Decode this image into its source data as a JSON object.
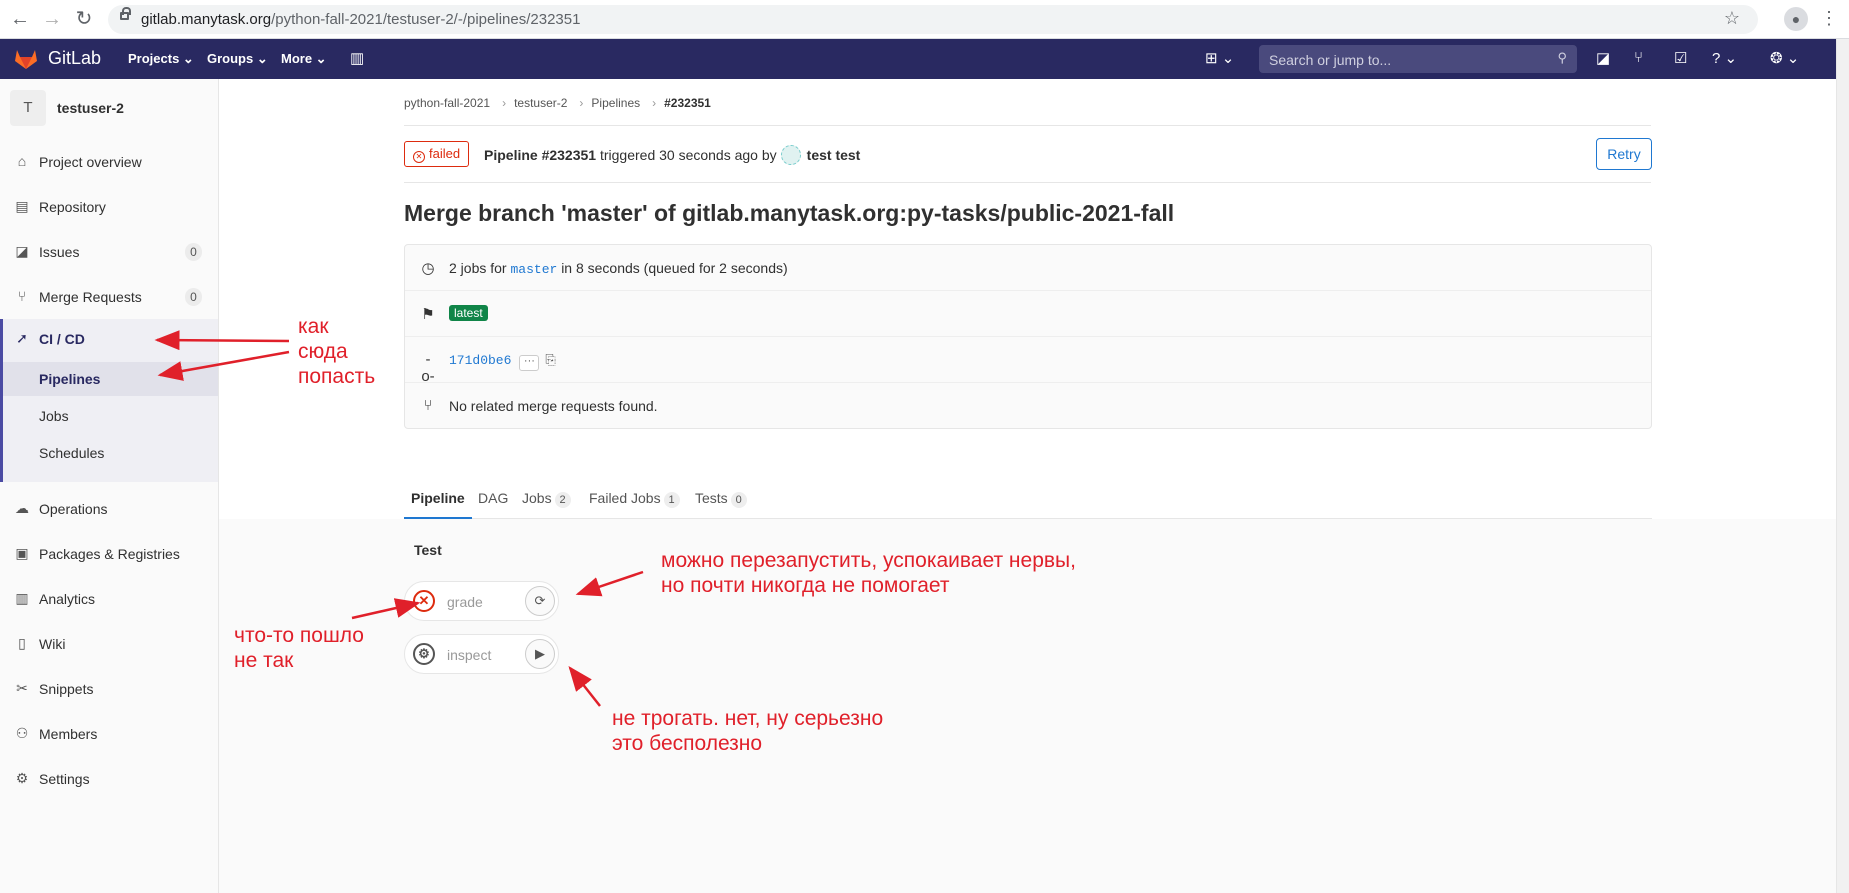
{
  "browser": {
    "url_host": "gitlab.manytask.org",
    "url_path": "/python-fall-2021/testuser-2/-/pipelines/232351"
  },
  "topbar": {
    "brand": "GitLab",
    "menus": [
      "Projects",
      "Groups",
      "More"
    ],
    "search_placeholder": "Search or jump to...",
    "accent": "#292961"
  },
  "sidebar": {
    "avatar_letter": "T",
    "project_name": "testuser-2",
    "items": [
      {
        "label": "Project overview",
        "icon": "home-icon"
      },
      {
        "label": "Repository",
        "icon": "doc-icon"
      },
      {
        "label": "Issues",
        "icon": "issues-icon",
        "count": "0"
      },
      {
        "label": "Merge Requests",
        "icon": "merge-request-icon",
        "count": "0"
      },
      {
        "label": "CI / CD",
        "icon": "rocket-icon"
      },
      {
        "label": "Operations",
        "icon": "cloud-icon"
      },
      {
        "label": "Packages & Registries",
        "icon": "package-icon"
      },
      {
        "label": "Analytics",
        "icon": "chart-icon"
      },
      {
        "label": "Wiki",
        "icon": "book-icon"
      },
      {
        "label": "Snippets",
        "icon": "scissors-icon"
      },
      {
        "label": "Members",
        "icon": "users-icon"
      },
      {
        "label": "Settings",
        "icon": "gear-icon"
      }
    ],
    "cicd_sub": [
      "Pipelines",
      "Jobs",
      "Schedules"
    ]
  },
  "breadcrumbs": [
    "python-fall-2021",
    "testuser-2",
    "Pipelines",
    "#232351"
  ],
  "pipeline": {
    "status": "failed",
    "id_label": "Pipeline #232351",
    "triggered_text": "triggered 30 seconds ago by",
    "user": "test test",
    "retry_label": "Retry",
    "title": "Merge branch 'master' of gitlab.manytask.org:py-tasks/public-2021-fall",
    "jobs_prefix": "2 jobs for",
    "branch": "master",
    "jobs_suffix": "in 8 seconds (queued for 2 seconds)",
    "latest_badge": "latest",
    "commit_sha": "171d0be6",
    "mr_text": "No related merge requests found."
  },
  "tabs": [
    {
      "label": "Pipeline",
      "count": ""
    },
    {
      "label": "DAG",
      "count": ""
    },
    {
      "label": "Jobs",
      "count": "2"
    },
    {
      "label": "Failed Jobs",
      "count": "1"
    },
    {
      "label": "Tests",
      "count": "0"
    }
  ],
  "stage": {
    "name": "Test",
    "jobs": [
      {
        "name": "grade",
        "status": "failed",
        "action": "retry"
      },
      {
        "name": "inspect",
        "status": "manual",
        "action": "play"
      }
    ]
  },
  "annotations": {
    "cicd": [
      "как",
      "сюда",
      "попасть"
    ],
    "retry": [
      "можно перезапустить, успокаивает нервы,",
      "но почти никогда не помогает"
    ],
    "failed": [
      "что-то пошло",
      "не так"
    ],
    "play": [
      "не трогать. нет, ну серьезно",
      "это бесполезно"
    ],
    "color": "#e0202a"
  }
}
